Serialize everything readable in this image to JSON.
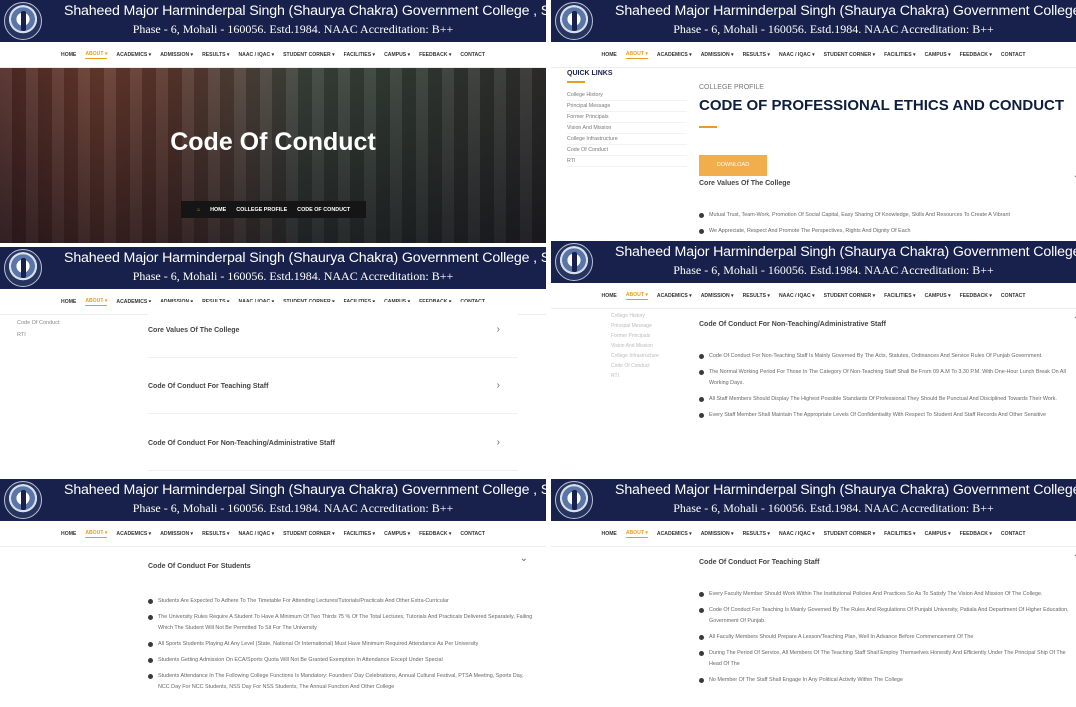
{
  "header": {
    "college_name": "Shaheed Major Harminderpal Singh (Shaurya Chakra) Government College , SAS Nagar",
    "subtitle": "Phase - 6, Mohali - 160056. Estd.1984. NAAC Accreditation: B++"
  },
  "nav": {
    "items": [
      "HOME",
      "ABOUT ▾",
      "ACADEMICS ▾",
      "ADMISSION ▾",
      "RESULTS ▾",
      "NAAC / IQAC ▾",
      "STUDENT CORNER ▾",
      "FACILITIES ▾",
      "CAMPUS ▾",
      "FEEDBACK ▾",
      "CONTACT"
    ],
    "active_index": 1
  },
  "hero": {
    "title": "Code Of Conduct",
    "breadcrumbs": [
      "HOME",
      "COLLEGE PROFILE",
      "CODE OF CONDUCT"
    ]
  },
  "sidebar": {
    "title": "QUICK LINKS",
    "items": [
      "College History",
      "Principal Message",
      "Former Principals",
      "Vision And Mission",
      "College Infrastructure",
      "Code Of Conduct",
      "RTI"
    ]
  },
  "profile": {
    "kicker": "COLLEGE PROFILE",
    "title": "CODE OF PROFESSIONAL ETHICS AND CONDUCT",
    "download": "DOWNLOAD"
  },
  "accordions": [
    "Core Values Of The College",
    "Code Of Conduct For Teaching Staff",
    "Code Of Conduct For Non-Teaching/Administrative Staff",
    "Code Of Conduct For Students"
  ],
  "core_values_items": [
    "Mutual Trust, Team-Work, Promotion Of Social Capital, Easy Sharing Of Knowledge, Skills And Resources To Create A Vibrant",
    "We Appreciate, Respect And Promote The Perspectives, Rights And Dignity Of Each"
  ],
  "nonteaching_items": [
    "Code Of Conduct For Non-Teaching Staff Is Mainly Governed By The Acts, Statutes, Ordinances And Service Rules Of Punjab Government.",
    "The Normal Working Period For Those In The Category Of Non-Teaching Staff Shall Be From 09 A.M To 3.30 P.M. With One-Hour Lunch Break On All Working Days.",
    "All Staff Members Should Display The Highest Possible Standards Of Professional They Should Be Punctual And Disciplined Towards Their Work.",
    "Every Staff Member Shall Maintain The Appropriate Levels Of Confidentiality With Respect To Student And Staff Records And Other Sensitive"
  ],
  "students_items": [
    "Students Are Expected To Adhere To The Timetable For Attending Lectures/Tutorials/Practicals And Other Extra-Curricular",
    "The University Rules Require A Student To Have A Minimum Of Two Thirds 75 % Of The Total Lectures, Tutorials And Practicals Delivered Separately, Failing Which The Student Will Not Be Permitted To Sit For The University",
    "All Sports Students Playing At Any Level (State, National Or International) Must Have Minimum Required Attendance As Per University",
    "Students Getting Admission On ECA/Sports Quota Will Not Be Granted Exemption In Attendance Except Under Special",
    "Students Attendance In The Following College Functions Is Mandatory: Founders' Day Celebrations, Annual Cultural Festival, PTSA Meeting, Sports Day, NCC Day For NCC Students, NSS Day For NSS Students, The Annual Function And Other College"
  ],
  "teaching_items": [
    "Every Faculty Member Should Work Within The Institutional Policies And Practices So As To Satisfy The Vision And Mission Of The College.",
    "Code Of Conduct For Teaching Is Mainly Governed By The Rules And Regulations Of Punjabi University, Patiala And Department Of Higher Education, Government Of Punjab.",
    "All Faculty Members Should Prepare A Lesson/Teaching Plan, Well In Advance Before Commencement Of The",
    "During The Period Of Service, All Members Of The Teaching Staff Shall Employ Themselves Honestly And Efficiently Under The Principal Ship Of The Head Of The",
    "No Member Of The Staff Shall Engage In Any Political Activity Within The College"
  ],
  "mini_sidebar": [
    "Code Of Conduct",
    "RTI"
  ]
}
